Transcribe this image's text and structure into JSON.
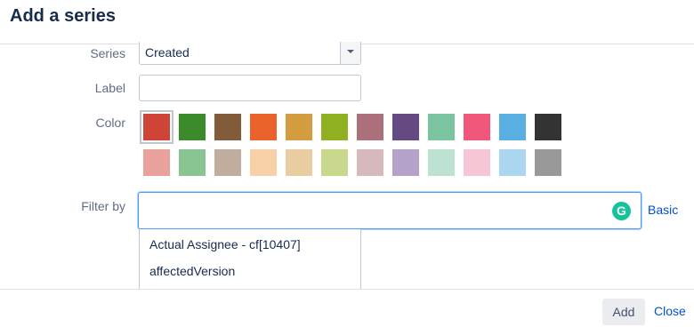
{
  "dialog": {
    "title": "Add a series"
  },
  "form": {
    "series_label": "Series",
    "series_value": "Created",
    "label_label": "Label",
    "label_value": "",
    "color_label": "Color",
    "filter_label": "Filter by",
    "filter_value": "",
    "basic_link": "Basic"
  },
  "colors": {
    "row1": [
      "#d04437",
      "#3b8b2b",
      "#815b3a",
      "#ea632b",
      "#d39c3f",
      "#8eb021",
      "#ac707a",
      "#654982",
      "#7ac4a0",
      "#f0577a",
      "#59afe1",
      "#333333"
    ],
    "row2": [
      "#e8a19b",
      "#89c592",
      "#c0ad9d",
      "#f8d1a9",
      "#e9cc9f",
      "#c8d98e",
      "#d7b8bd",
      "#b4a2c8",
      "#bde2d1",
      "#f6c6d5",
      "#acd6f0",
      "#999999"
    ],
    "selected": "#d04437"
  },
  "suggestions": [
    "Actual Assignee - cf[10407]",
    "affectedVersion"
  ],
  "footer": {
    "add_label": "Add",
    "close_label": "Close"
  }
}
